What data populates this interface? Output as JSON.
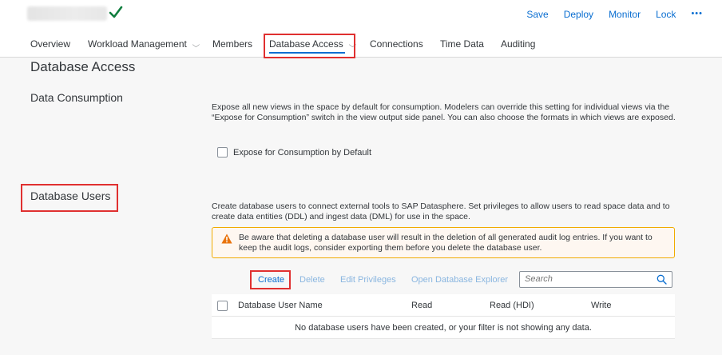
{
  "header": {
    "actions": [
      "Save",
      "Deploy",
      "Monitor",
      "Lock"
    ],
    "more_label": "•••"
  },
  "tabs": [
    "Overview",
    "Workload Management",
    "Members",
    "Database Access",
    "Connections",
    "Time Data",
    "Auditing"
  ],
  "page_title": "Database Access",
  "data_consumption": {
    "title": "Data Consumption",
    "description": "Expose all new views in the space by default for consumption. Modelers can override this setting for individual views via the “Expose for Consumption” switch in the view output side panel. You can also choose the formats in which views are exposed.",
    "checkbox_label": "Expose for Consumption by Default"
  },
  "database_users": {
    "title": "Database Users",
    "description": "Create database users to connect external tools to SAP Datasphere. Set privileges to allow users to read space data and to create data entities (DDL) and ingest data (DML) for use in the space.",
    "warning": "Be aware that deleting a database user will result in the deletion of all generated audit log entries. If you want to keep the audit logs, consider exporting them before you delete the database user.",
    "toolbar": {
      "create": "Create",
      "delete": "Delete",
      "edit_privileges": "Edit Privileges",
      "open_explorer": "Open Database Explorer",
      "search_placeholder": "Search"
    },
    "columns": [
      "Database User Name",
      "Read",
      "Read (HDI)",
      "Write"
    ],
    "empty_text": "No database users have been created, or your filter is not showing any data."
  },
  "colors": {
    "accent": "#0a6ed1",
    "success": "#107e3e",
    "warning": "#e9730c",
    "highlight_box": "#e03030"
  }
}
